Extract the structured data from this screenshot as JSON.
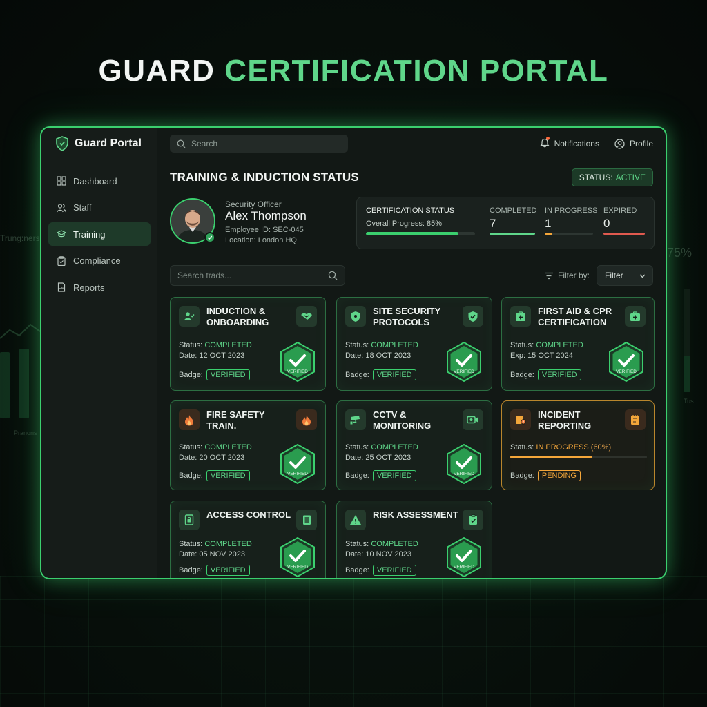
{
  "hero": {
    "word1": "GUARD",
    "word2": "CERTIFICATION PORTAL"
  },
  "sidebar": {
    "brand": "Guard Portal",
    "items": [
      {
        "label": "Dashboard",
        "icon": "grid-icon",
        "active": false
      },
      {
        "label": "Staff",
        "icon": "users-icon",
        "active": false
      },
      {
        "label": "Training",
        "icon": "graduation-cap-icon",
        "active": true
      },
      {
        "label": "Compliance",
        "icon": "clipboard-icon",
        "active": false
      },
      {
        "label": "Reports",
        "icon": "document-icon",
        "active": false
      }
    ]
  },
  "topbar": {
    "search_placeholder": "Search",
    "notifications": "Notifications",
    "profile": "Profile"
  },
  "page": {
    "title": "TRAINING & INDUCTION STATUS",
    "status_label": "STATUS:",
    "status_value": "ACTIVE"
  },
  "officer": {
    "role": "Security Officer",
    "name": "Alex Thompson",
    "employee_id": "Employee ID: SEC-045",
    "location": "Location: London HQ"
  },
  "certification": {
    "title": "CERTIFICATION STATUS",
    "overall_label": "Overall Progress: 85%",
    "overall_progress": 0.85,
    "stats": [
      {
        "label": "COMPLETED",
        "value": "7",
        "color": "#5fd68a",
        "fill": 1.0
      },
      {
        "label": "IN PROGRESS",
        "value": "1",
        "color": "#f4a63a",
        "fill": 0.14
      },
      {
        "label": "EXPIRED",
        "value": "0",
        "color": "#e05a4f",
        "fill": 1.0
      }
    ]
  },
  "list_controls": {
    "search_placeholder": "Search trads...",
    "filter_label": "Filter by:",
    "filter_value": "Filter"
  },
  "cards": [
    {
      "title": "INDUCTION & ONBOARDING",
      "icon_left": "person-check-icon",
      "icon_right": "handshake-icon",
      "status_label": "Status:",
      "status": "COMPLETED",
      "date": "Date: 12 OCT 2023",
      "badge_label": "Badge:",
      "badge": "VERIFIED",
      "hex_text": "VERIFIED"
    },
    {
      "title": "SITE SECURITY PROTOCOLS",
      "icon_left": "shield-icon",
      "icon_right": "shield-check-icon",
      "status_label": "Status:",
      "status": "COMPLETED",
      "date": "Date: 18 OCT 2023",
      "badge_label": "Badge:",
      "badge": "VERIFIED",
      "hex_text": "VERIFIED"
    },
    {
      "title": "FIRST AID & CPR CERTIFICATION",
      "icon_left": "first-aid-icon",
      "icon_right": "first-aid-kit-icon",
      "status_label": "Status:",
      "status": "COMPLETED",
      "date": "Exp: 15 OCT 2024",
      "badge_label": "Badge:",
      "badge": "VERIFIED",
      "hex_text": "VERIFIED"
    },
    {
      "title": "FIRE SAFETY TRAIN.",
      "icon_left": "flame-icon",
      "icon_right": "flame-icon",
      "status_label": "Status:",
      "status": "COMPLETED",
      "date": "Date: 20 OCT 2023",
      "badge_label": "Badge:",
      "badge": "VERIFIED",
      "hex_text": "VERIFIED"
    },
    {
      "title": "CCTV & MONITORING",
      "icon_left": "cctv-camera-icon",
      "icon_right": "video-camera-icon",
      "status_label": "Status:",
      "status": "COMPLETED",
      "date": "Date: 25 OCT 2023",
      "badge_label": "Badge:",
      "badge": "VERIFIED",
      "hex_text": "VERIFIED"
    },
    {
      "title": "INCIDENT REPORTING",
      "icon_left": "report-icon",
      "icon_right": "notepad-icon",
      "status_label": "Status:",
      "status": "IN PROGRESS",
      "status_extra": "(60%)",
      "progress": 0.6,
      "badge_label": "Badge:",
      "badge": "PENDING"
    },
    {
      "title": "ACCESS CONTROL",
      "icon_left": "keycard-icon",
      "icon_right": "checklist-icon",
      "status_label": "Status:",
      "status": "COMPLETED",
      "date": "Date: 05 NOV 2023",
      "badge_label": "Badge:",
      "badge": "VERIFIED",
      "hex_text": "VERIFIED"
    },
    {
      "title": "RISK ASSESSMENT",
      "icon_left": "warning-icon",
      "icon_right": "clipboard-check-icon",
      "status_label": "Status:",
      "status": "COMPLETED",
      "date": "Date: 10 NOV 2023",
      "badge_label": "Badge:",
      "badge": "VERIFIED",
      "hex_text": "VERIFIED"
    }
  ],
  "background": {
    "left_text_1": "Trung:ners",
    "left_text_2": "Pranons",
    "right_text_1": "75%",
    "right_text_2": "Tus"
  },
  "colors": {
    "accent": "#3bcf6e",
    "accent_text": "#5fd68a",
    "warning": "#f4a63a",
    "danger": "#e05a4f"
  }
}
